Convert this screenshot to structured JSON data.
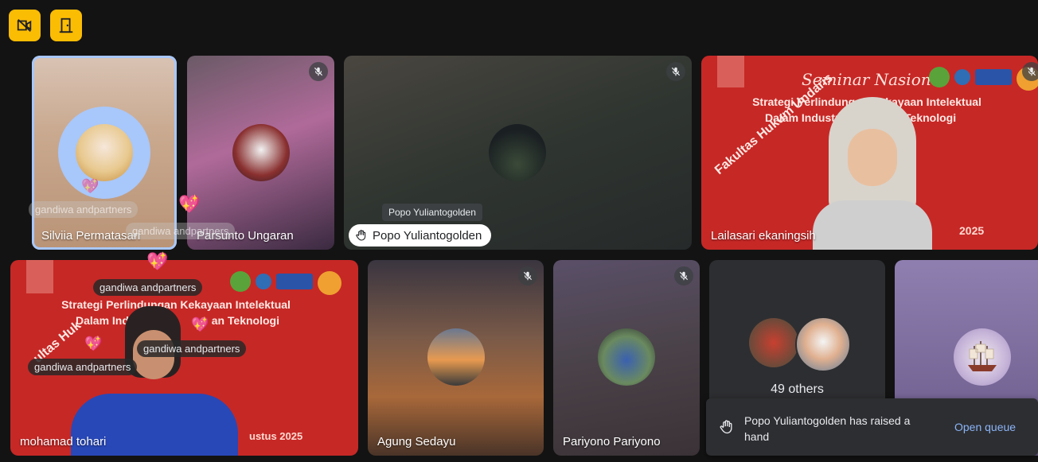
{
  "top_buttons": [
    {
      "icon": "video-off-icon"
    },
    {
      "icon": "door-exit-icon"
    }
  ],
  "tiles": {
    "silvia": {
      "name": "Silviia Permatasari"
    },
    "parsunto": {
      "name": "Parsunto Ungaran"
    },
    "popo": {
      "name": "Popo Yuliantogolden",
      "tooltip": "Popo Yuliantogolden"
    },
    "lailasari": {
      "name": "Lailasari ekaningsih"
    },
    "tohari": {
      "name": "mohamad tohari"
    },
    "agung": {
      "name": "Agung Sedayu"
    },
    "pariyono": {
      "name": "Pariyono Pariyono"
    },
    "others": {
      "label": "49 others"
    }
  },
  "banner": {
    "title": "Seminar Nasional",
    "line1": "Strategi Perlindungan Kekayaan Intelektual",
    "line1_partial": "Strategi Perlindungan Kekayaan Intelektual",
    "line2": "Dalam Industri",
    "line2_end": "Teknologi",
    "line2_partial_start": "Dalam Ind",
    "line2_partial_end": "an Teknologi",
    "side_text": "Fakultas Hukum Undaris",
    "side_text_partial": "ultas Huk",
    "year_partial": "2025",
    "date_partial": "ustus 2025"
  },
  "reactions": {
    "sender": "gandiwa andpartners"
  },
  "toast": {
    "message": "Popo Yuliantogolden has raised a hand",
    "action": "Open queue"
  },
  "colors": {
    "accent_yellow": "#fbbc04",
    "speaking_border": "#a8c7fa",
    "banner_red": "#c62826",
    "link_blue": "#8ab4f8"
  }
}
